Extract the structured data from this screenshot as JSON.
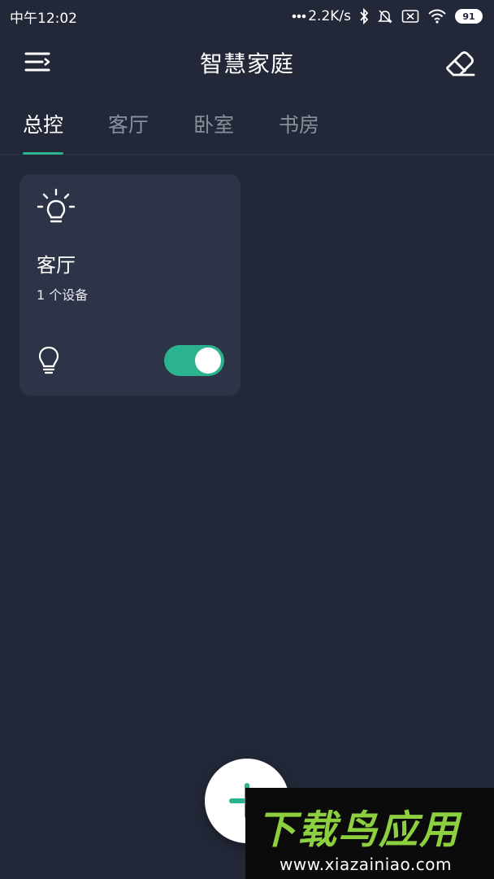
{
  "status_bar": {
    "time": "中午12:02",
    "network_speed": "2.2K/s",
    "battery": "91",
    "icons": [
      "dots-icon",
      "bluetooth-icon",
      "bell-muted-icon",
      "sim-off-icon",
      "wifi-icon",
      "battery-icon"
    ]
  },
  "header": {
    "title": "智慧家庭",
    "left_icon": "menu-icon",
    "right_icon": "eraser-icon"
  },
  "tabs": [
    {
      "label": "总控",
      "active": true
    },
    {
      "label": "客厅",
      "active": false
    },
    {
      "label": "卧室",
      "active": false
    },
    {
      "label": "书房",
      "active": false
    }
  ],
  "rooms": [
    {
      "name": "客厅",
      "device_count": "1 个设备",
      "icon": "lightbulb-sun-icon",
      "device_icon": "lightbulb-icon",
      "switch_on": true
    }
  ],
  "fab": {
    "icon": "plus-icon"
  },
  "watermark": {
    "title": "下载鸟应用",
    "url": "www.xiazainiao.com"
  },
  "colors": {
    "background": "#232838",
    "card": "#2e3447",
    "accent": "#2bb38f",
    "inactive_tab": "#8a8f9c"
  }
}
